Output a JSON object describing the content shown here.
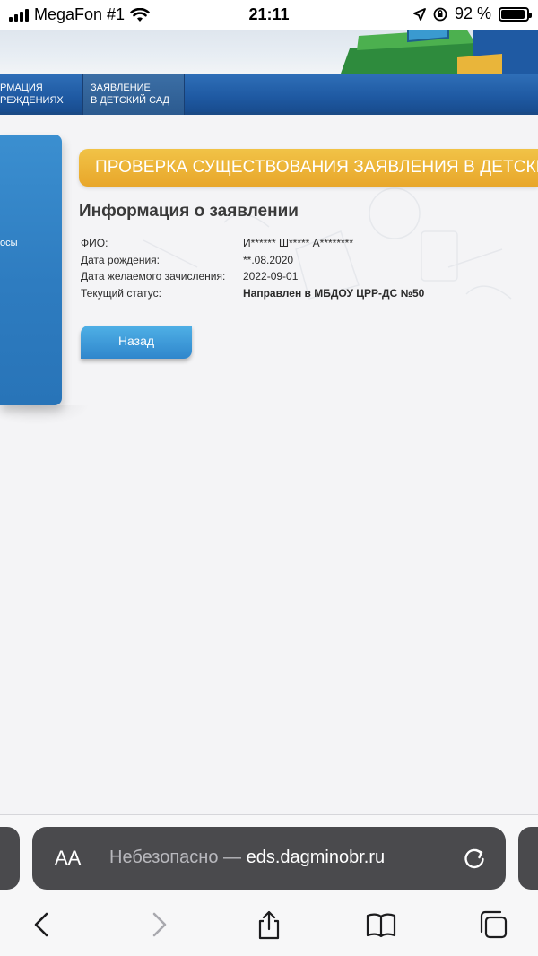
{
  "status_bar": {
    "carrier": "MegaFon #1",
    "time": "21:11",
    "battery_percent": "92 %",
    "battery_level": 0.92
  },
  "nav": {
    "items": [
      {
        "label_line1": "РМАЦИЯ",
        "label_line2": "РЕЖДЕНИЯХ"
      },
      {
        "label_line1": "ЗАЯВЛЕНИЕ",
        "label_line2": "В ДЕТСКИЙ САД"
      }
    ]
  },
  "sidebar": {
    "partial_label": "осы"
  },
  "banner": {
    "title": "ПРОВЕРКА СУЩЕСТВОВАНИЯ ЗАЯВЛЕНИЯ В ДЕТСКИЙ"
  },
  "application": {
    "section_title": "Информация о заявлении",
    "rows": [
      {
        "label": "ФИО:",
        "value": "И****** Ш***** А********"
      },
      {
        "label": "Дата рождения:",
        "value": "**.08.2020"
      },
      {
        "label": "Дата желаемого зачисления:",
        "value": "2022-09-01"
      },
      {
        "label": "Текущий статус:",
        "value": "Направлен в МБДОУ ЦРР-ДС №50"
      }
    ],
    "back_button": "Назад"
  },
  "browser": {
    "aa_label": "AA",
    "url_prefix": "Небезопасно —",
    "url_host": "eds.dagminobr.ru"
  },
  "icons": {
    "back": "chevron-left-icon",
    "forward": "chevron-right-icon",
    "share": "share-icon",
    "bookmarks": "book-icon",
    "tabs": "tabs-icon"
  }
}
